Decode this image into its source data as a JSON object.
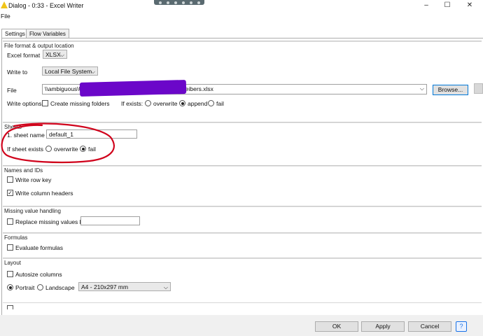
{
  "window": {
    "title": "Dialog - 0:33 - Excel Writer",
    "minimize": "–",
    "maximize": "☐",
    "close": "✕"
  },
  "menu": {
    "file": "File"
  },
  "tabs": [
    {
      "label": "Settings",
      "active": true
    },
    {
      "label": "Flow Variables",
      "active": false
    }
  ],
  "file_format": {
    "legend": "File format & output location",
    "excel_format_label": "Excel format",
    "excel_format_value": "XLSX",
    "write_to_label": "Write to",
    "write_to_value": "Local File System",
    "file_label": "File",
    "file_path": "\\\\ambiguous\\Users\\Everyone\\Desktop\\Parameterschreibers.xlsx",
    "browse_label": "Browse...",
    "write_options_label": "Write options",
    "create_missing_folders": "Create missing folders",
    "if_exists_label": "If exists:",
    "if_exists_options": [
      "overwrite",
      "append",
      "fail"
    ],
    "if_exists_selected": "append"
  },
  "sheets": {
    "legend": "Sheets",
    "sheet_name_label": "1. sheet name",
    "sheet_name_value": "default_1",
    "if_sheet_exists_label": "If sheet exists",
    "if_sheet_exists_options": [
      "overwrite",
      "fail"
    ],
    "if_sheet_exists_selected": "fail"
  },
  "names_ids": {
    "legend": "Names and IDs",
    "write_row_key": "Write row key",
    "write_row_key_checked": false,
    "write_column_headers": "Write column headers",
    "write_column_headers_checked": true
  },
  "missing": {
    "legend": "Missing value handling",
    "replace_label": "Replace missing values by",
    "replace_value": ""
  },
  "formulas": {
    "legend": "Formulas",
    "evaluate_label": "Evaluate formulas"
  },
  "layout": {
    "legend": "Layout",
    "autosize_label": "Autosize columns",
    "portrait_label": "Portrait",
    "landscape_label": "Landscape",
    "paper_size": "A4 - 210x297 mm"
  },
  "footer": {
    "ok": "OK",
    "apply": "Apply",
    "cancel": "Cancel",
    "help": "?"
  },
  "colors": {
    "annotation_red": "#d0021b",
    "redaction_purple": "#6b07c9",
    "accent_blue": "#0078d7"
  }
}
